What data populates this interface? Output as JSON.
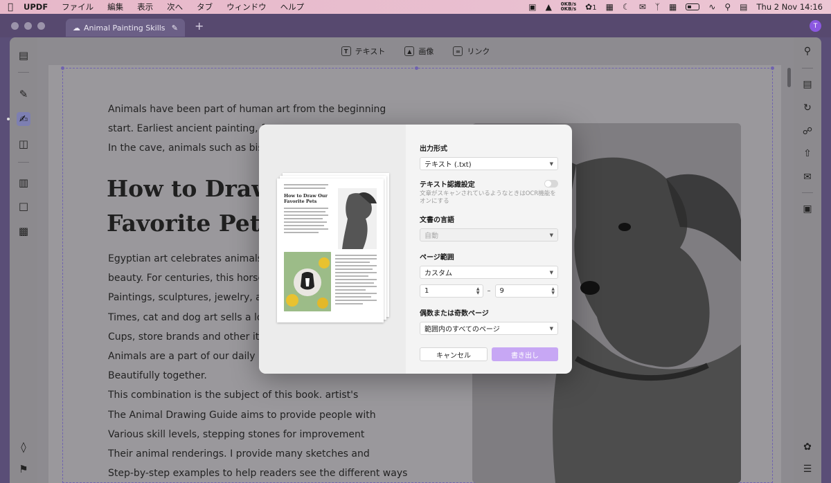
{
  "menubar": {
    "app": "UPDF",
    "menus": [
      "ファイル",
      "編集",
      "表示",
      "次へ",
      "タブ",
      "ウィンドウ",
      "ヘルプ"
    ],
    "net_up": "0KB/s",
    "net_down": "0KB/s",
    "badge_count": "1",
    "datetime": "Thu 2 Nov  14:16"
  },
  "window": {
    "tab_title": "Animal Painting Skills",
    "avatar_letter": "T"
  },
  "edit_toolbar": {
    "text_label": "テキスト",
    "image_label": "画像",
    "link_label": "リンク"
  },
  "document": {
    "intro_lines": [
      "Animals have been part of human art from the beginning",
      "start. Earliest ancient painting, f",
      "In the cave, animals such as bisc"
    ],
    "heading_lines": [
      "How to Draw",
      "Favorite Pets"
    ],
    "body_lines": [
      "Egyptian art celebrates animals",
      "beauty. For centuries, this horse",
      "Paintings, sculptures, jewelry, ar",
      "Times, cat and dog art sells a lot",
      "Cups, store brands and other ite",
      "Animals are a part of our daily lif",
      "Beautifully together.",
      "This combination is the subject of this book. artist's",
      "The Animal Drawing Guide aims to provide people with",
      "Various skill levels, stepping stones for improvement",
      "Their animal renderings. I provide many sketches and",
      "Step-by-step examples to help readers see the different ways"
    ]
  },
  "dialog": {
    "thumbnail_title": "How to Draw Our Favorite Pets",
    "output_format_label": "出力形式",
    "output_format_value": "テキスト (.txt)",
    "ocr_label": "テキスト認識設定",
    "ocr_hint": "文章がスキャンされているようなときはOCR機能をオンにする",
    "language_label": "文書の言語",
    "language_value": "自動",
    "page_range_label": "ページ範囲",
    "page_range_value": "カスタム",
    "range_from": "1",
    "range_to": "9",
    "odd_even_label": "偶数または奇数ページ",
    "odd_even_value": "範囲内のすべてのページ",
    "cancel_label": "キャンセル",
    "export_label": "書き出し",
    "accent_color": "#c7a7f4"
  }
}
